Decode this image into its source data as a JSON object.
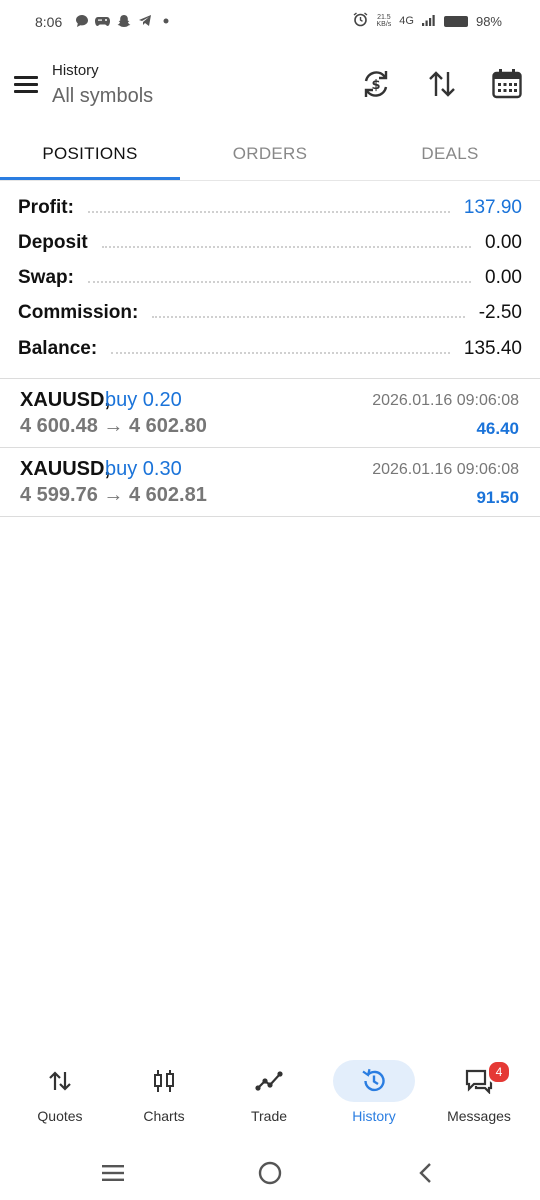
{
  "status_bar": {
    "time": "8:06",
    "network_speed_top": "21.5",
    "network_speed_bottom": "KB/s",
    "network_type": "4G",
    "battery": "98%"
  },
  "app_bar": {
    "title": "History",
    "subtitle": "All symbols"
  },
  "tabs": [
    {
      "label": "POSITIONS",
      "active": true
    },
    {
      "label": "ORDERS",
      "active": false
    },
    {
      "label": "DEALS",
      "active": false
    }
  ],
  "summary": [
    {
      "label": "Profit:",
      "value": "137.90",
      "highlight": true
    },
    {
      "label": "Deposit",
      "value": "0.00",
      "highlight": false
    },
    {
      "label": "Swap:",
      "value": "0.00",
      "highlight": false
    },
    {
      "label": "Commission:",
      "value": "-2.50",
      "highlight": false
    },
    {
      "label": "Balance:",
      "value": "135.40",
      "highlight": false
    }
  ],
  "deals": [
    {
      "symbol": "XAUUSD,",
      "side": "buy 0.20",
      "time": "2026.01.16 09:06:08",
      "prices": "4 600.48 → 4 602.80",
      "profit": "46.40"
    },
    {
      "symbol": "XAUUSD,",
      "side": "buy 0.30",
      "time": "2026.01.16 09:06:08",
      "prices": "4 599.76 → 4 602.81",
      "profit": "91.50"
    }
  ],
  "bottom_nav": [
    {
      "label": "Quotes",
      "icon": "quotes-icon",
      "active": false
    },
    {
      "label": "Charts",
      "icon": "charts-icon",
      "active": false
    },
    {
      "label": "Trade",
      "icon": "trade-icon",
      "active": false
    },
    {
      "label": "History",
      "icon": "history-icon",
      "active": true
    },
    {
      "label": "Messages",
      "icon": "messages-icon",
      "active": false,
      "badge": "4"
    }
  ],
  "colors": {
    "accent": "#2a7de1",
    "profit_blue": "#1a73d9",
    "badge_red": "#e53935"
  }
}
